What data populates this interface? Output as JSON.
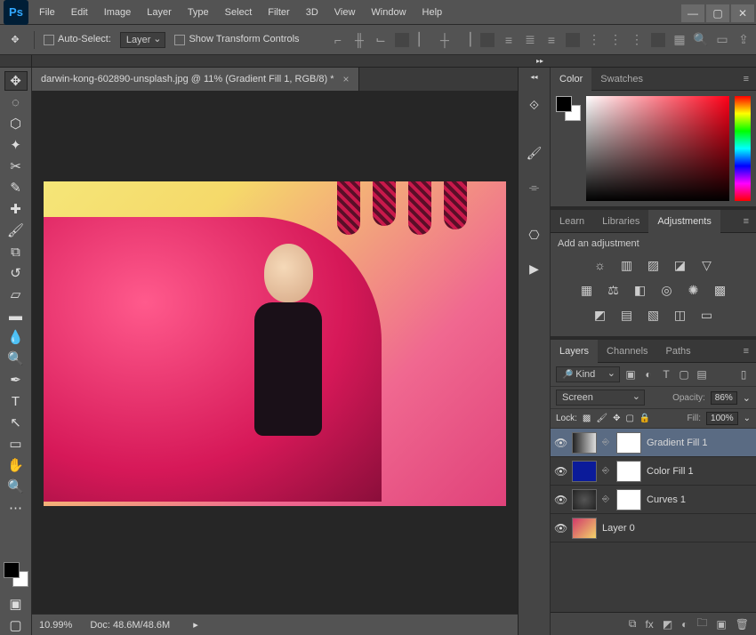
{
  "menubar": [
    "File",
    "Edit",
    "Image",
    "Layer",
    "Type",
    "Select",
    "Filter",
    "3D",
    "View",
    "Window",
    "Help"
  ],
  "options": {
    "auto_select_label": "Auto-Select:",
    "auto_select_target": "Layer",
    "show_transform": "Show Transform Controls"
  },
  "document": {
    "tab_title": "darwin-kong-602890-unsplash.jpg @ 11% (Gradient Fill 1, RGB/8) *",
    "zoom": "10.99%",
    "doc_info": "Doc: 48.6M/48.6M"
  },
  "panels": {
    "color": {
      "tabs": [
        "Color",
        "Swatches"
      ]
    },
    "adjust": {
      "tabs": [
        "Learn",
        "Libraries",
        "Adjustments"
      ],
      "heading": "Add an adjustment"
    },
    "layers": {
      "tabs": [
        "Layers",
        "Channels",
        "Paths"
      ],
      "filter": "Kind",
      "blend_mode": "Screen",
      "opacity_label": "Opacity:",
      "opacity": "86%",
      "lock_label": "Lock:",
      "fill_label": "Fill:",
      "fill": "100%",
      "items": [
        {
          "name": "Gradient Fill 1"
        },
        {
          "name": "Color Fill 1"
        },
        {
          "name": "Curves 1"
        },
        {
          "name": "Layer 0"
        }
      ]
    }
  }
}
